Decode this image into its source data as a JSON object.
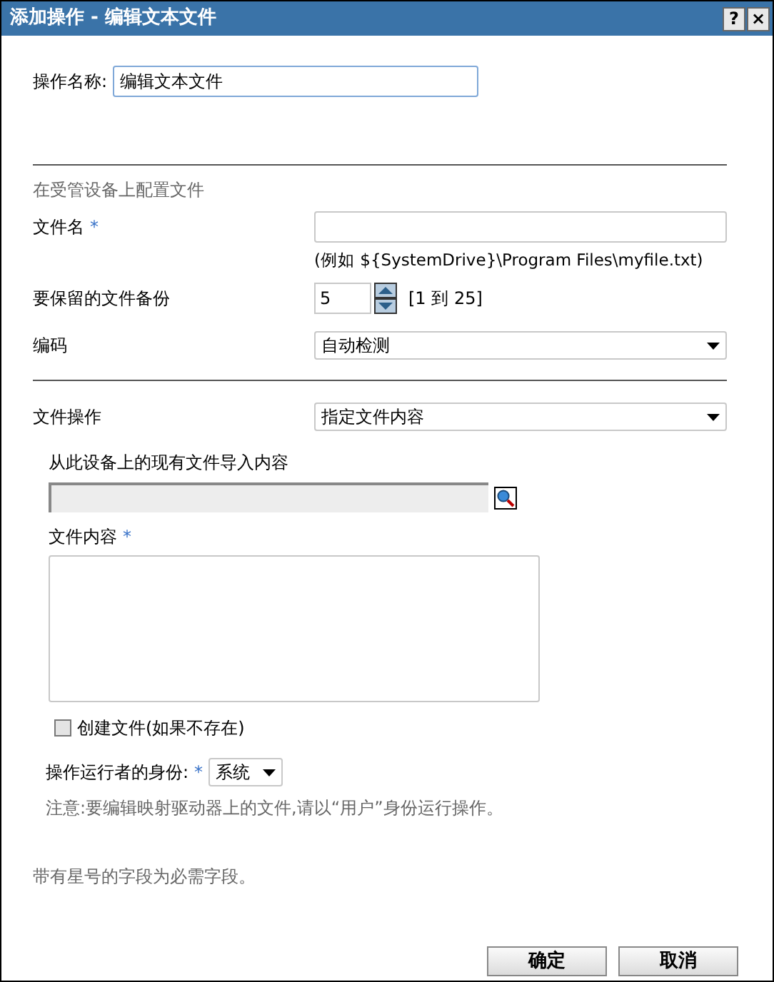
{
  "window": {
    "title": "添加操作 - 编辑文本文件",
    "buttons": [
      "?",
      "×"
    ]
  },
  "action_name": {
    "label": "操作名称:",
    "value": "编辑文本文件"
  },
  "section_title": "在受管设备上配置文件",
  "file_name": {
    "label": "文件名",
    "required_mark": "*",
    "hint": "(例如 ${SystemDrive}\\Program Files\\myfile.txt)"
  },
  "backups": {
    "label": "要保留的文件备份",
    "value": "5",
    "range": "[1 到 25]"
  },
  "encoding": {
    "label": "编码",
    "value": "自动检测"
  },
  "file_operation": {
    "label": "文件操作",
    "value": "指定文件内容"
  },
  "import": {
    "label": "从此设备上的现有文件导入内容"
  },
  "file_content": {
    "label": "文件内容",
    "required_mark": "*"
  },
  "create_file": {
    "label": "创建文件(如果不存在)",
    "checked": false
  },
  "run_as": {
    "label": "操作运行者的身份:",
    "required_mark": "*",
    "value": "系统",
    "note": "注意:要编辑映射驱动器上的文件,请以“用户”身份运行操作。"
  },
  "required_note": "带有星号的字段为必需字段。",
  "buttons": [
    "确定",
    "取消"
  ]
}
